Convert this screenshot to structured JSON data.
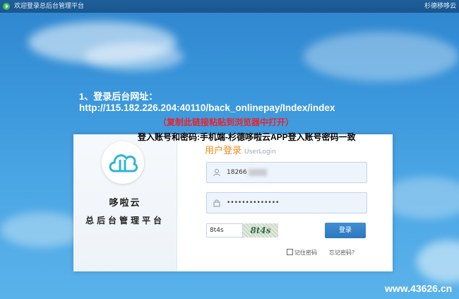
{
  "window": {
    "title": "欢迎登录总后台管理平台",
    "right_text": "杉德移哆云"
  },
  "annotations": {
    "step_title": "1、登录后台网址：",
    "url": "http://115.182.226.204:40110/back_onlinepay/Index/index",
    "copy_note": "（复制此链接粘贴到浏览器中打开）",
    "account_note": "登入账号和密码:手机端-杉德哆啦云APP登入账号密码一致"
  },
  "brand": {
    "name": "哆啦云",
    "subtitle": "总后台管理平台"
  },
  "login": {
    "title": "用户登录",
    "title_en": "UserLogin",
    "username_value": "18266",
    "password_value": "••••••••••••••",
    "captcha_value": "8t4s",
    "captcha_image_text": "8t4s",
    "login_button": "登录",
    "remember_label": "记住密码",
    "forgot_label": "忘记密码？"
  },
  "watermark": "www.43626.cn",
  "colors": {
    "accent_orange": "#f08a1e",
    "warning_red": "#e8232f",
    "button_blue": "#2d79bd"
  }
}
